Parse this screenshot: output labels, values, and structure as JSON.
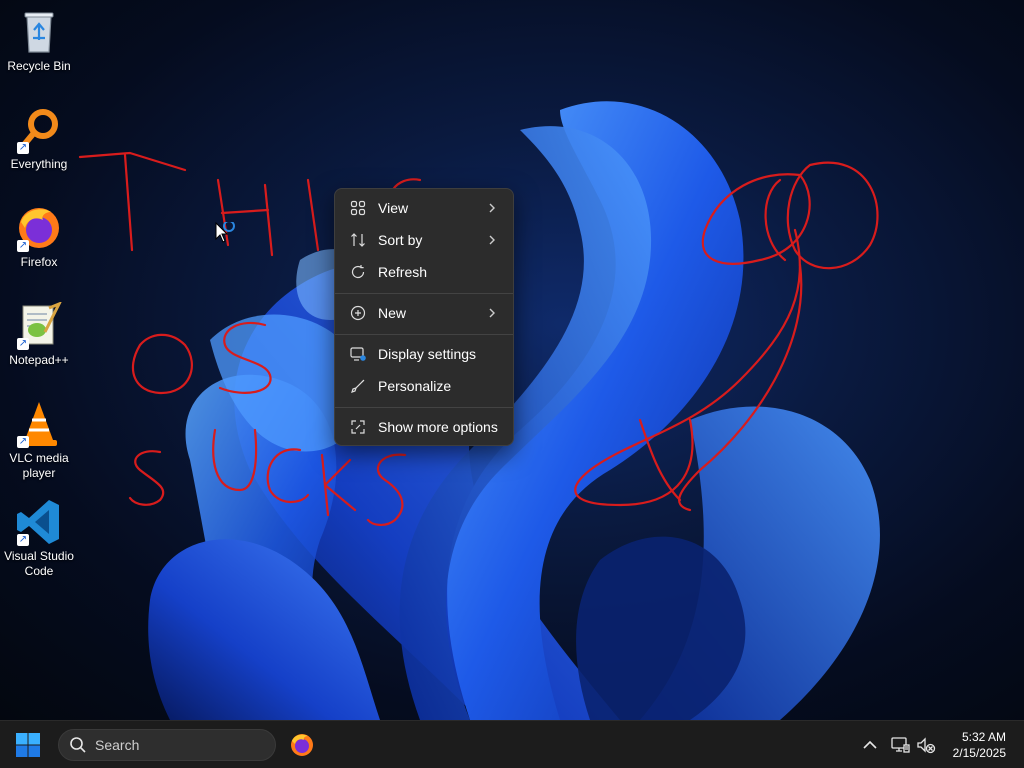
{
  "desktop_icons": [
    {
      "label": "Recycle Bin",
      "icon": "recycle-bin-icon",
      "shortcut": false
    },
    {
      "label": "Everything",
      "icon": "everything-search-icon",
      "shortcut": true
    },
    {
      "label": "Firefox",
      "icon": "firefox-icon",
      "shortcut": true
    },
    {
      "label": "Notepad++",
      "icon": "notepad-plus-plus-icon",
      "shortcut": true
    },
    {
      "label": "VLC media player",
      "icon": "vlc-icon",
      "shortcut": true
    },
    {
      "label": "Visual Studio Code",
      "icon": "vscode-icon",
      "shortcut": true
    }
  ],
  "context_menu": {
    "items": [
      {
        "label": "View",
        "icon": "grid-view-icon",
        "submenu": true
      },
      {
        "label": "Sort by",
        "icon": "sort-icon",
        "submenu": true
      },
      {
        "label": "Refresh",
        "icon": "refresh-icon",
        "submenu": false
      },
      {
        "label": "New",
        "icon": "plus-circle-icon",
        "submenu": true
      },
      {
        "label": "Display settings",
        "icon": "display-settings-icon",
        "submenu": false
      },
      {
        "label": "Personalize",
        "icon": "brush-icon",
        "submenu": false
      },
      {
        "label": "Show more options",
        "icon": "show-more-options-icon",
        "submenu": false
      }
    ]
  },
  "taskbar": {
    "search_placeholder": "Search",
    "pinned_apps": [
      "firefox-icon"
    ],
    "tray_icons": [
      "chevron-up-icon",
      "network-icon",
      "volume-muted-icon"
    ],
    "clock": {
      "time": "5:32 AM",
      "date": "2/15/2025"
    }
  },
  "colors": {
    "menu_bg": "#2c2c2c",
    "taskbar_bg": "#1c1c1c",
    "scribble": "#d81c1c",
    "accent": "#1f7ae6"
  }
}
